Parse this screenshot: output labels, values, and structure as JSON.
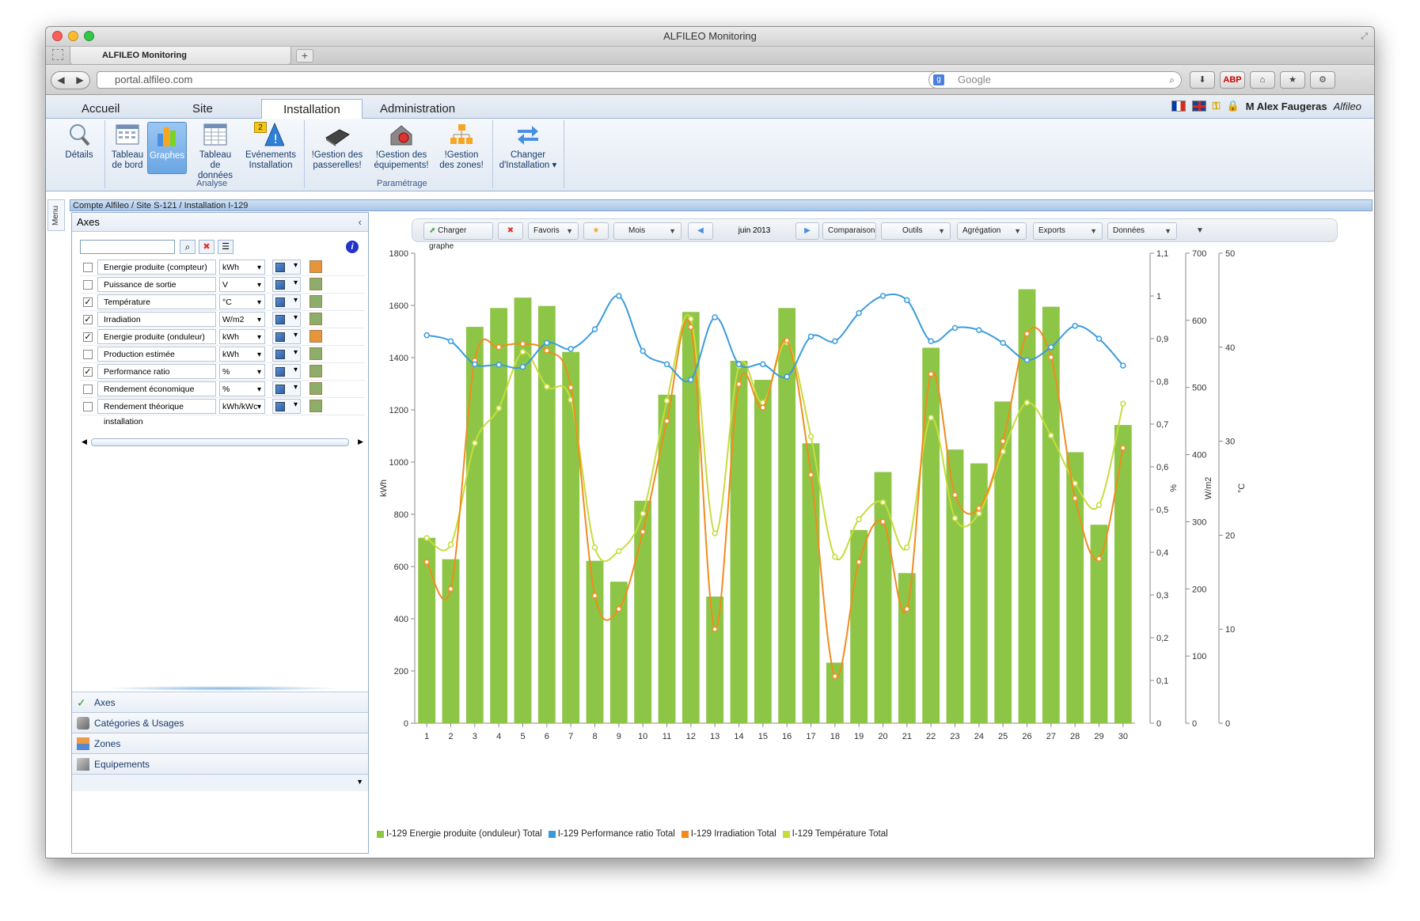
{
  "window": {
    "title": "ALFILEO Monitoring"
  },
  "browser": {
    "tab_title": "ALFILEO Monitoring",
    "url": "portal.alfileo.com",
    "search_placeholder": "Google"
  },
  "ribbon_tabs": [
    "Accueil",
    "Site",
    "Installation",
    "Administration"
  ],
  "user": {
    "name": "M Alex Faugeras",
    "org": "Alfileo"
  },
  "ribbon": {
    "details": "Détails",
    "tableau_bord": [
      "Tableau",
      "de bord"
    ],
    "graphes": "Graphes",
    "tableau_donnees": [
      "Tableau",
      "de données"
    ],
    "evenements": [
      "Evénements",
      "Installation"
    ],
    "evenements_badge": "2",
    "gestion_passerelles": [
      "!Gestion des",
      "passerelles!"
    ],
    "gestion_equipements": [
      "!Gestion des",
      "équipements!"
    ],
    "gestion_zones": [
      "!Gestion",
      "des zones!"
    ],
    "changer": [
      "Changer",
      "d'Installation ▾"
    ],
    "group_analyse": "Analyse",
    "group_parametrage": "Paramétrage"
  },
  "breadcrumb": "Compte Alfileo / Site S-121 / Installation I-129",
  "menu_tab": "Menu",
  "panel": {
    "title": "Axes",
    "rows": [
      {
        "name": "Energie produite (compteur)",
        "unit": "kWh",
        "checked": false,
        "color": "#e8943a"
      },
      {
        "name": "Puissance de sortie",
        "unit": "V",
        "checked": false,
        "color": "#8cae6a"
      },
      {
        "name": "Température",
        "unit": "°C",
        "checked": true,
        "color": "#8cae6a"
      },
      {
        "name": "Irradiation",
        "unit": "W/m2",
        "checked": true,
        "color": "#8cae6a"
      },
      {
        "name": "Energie produite (onduleur)",
        "unit": "kWh",
        "checked": true,
        "color": "#e8943a"
      },
      {
        "name": "Production estimée",
        "unit": "kWh",
        "checked": false,
        "color": "#8cae6a"
      },
      {
        "name": "Performance ratio",
        "unit": "%",
        "checked": true,
        "color": "#8cae6a"
      },
      {
        "name": "Rendement économique installation",
        "unit": "%",
        "checked": false,
        "color": "#8cae6a"
      },
      {
        "name": "Rendement théorique installation",
        "unit": "kWh/kWc",
        "checked": false,
        "color": "#8cae6a"
      }
    ],
    "accordion": [
      "Axes",
      "Catégories & Usages",
      "Zones",
      "Equipements"
    ]
  },
  "chart_toolbar": {
    "charger": "Charger graphe",
    "favoris": "Favoris",
    "mois": "Mois",
    "period": "juin 2013",
    "comparaison": "Comparaison",
    "outils": "Outils",
    "agregation": "Agrégation",
    "exports": "Exports",
    "donnees": "Données"
  },
  "chart_data": {
    "type": "bar",
    "categories": [
      "1",
      "2",
      "3",
      "4",
      "5",
      "6",
      "7",
      "8",
      "9",
      "10",
      "11",
      "12",
      "13",
      "14",
      "15",
      "16",
      "17",
      "18",
      "19",
      "20",
      "21",
      "22",
      "23",
      "24",
      "25",
      "26",
      "27",
      "28",
      "29",
      "30"
    ],
    "series": [
      {
        "name": "I-129 Energie produite (onduleur) Total",
        "type": "bar",
        "axis": "kWh",
        "color": "#8dc647",
        "values": [
          710,
          628,
          1518,
          1590,
          1630,
          1598,
          1422,
          622,
          542,
          852,
          1258,
          1575,
          485,
          1388,
          1315,
          1590,
          1072,
          232,
          740,
          962,
          575,
          1438,
          1048,
          995,
          1232,
          1662,
          1595,
          1038,
          760,
          1142
        ]
      },
      {
        "name": "I-129 Performance ratio Total",
        "type": "line",
        "axis": "%",
        "color": "#3a9bdc",
        "values": [
          0.908,
          0.894,
          0.84,
          0.839,
          0.834,
          0.89,
          0.876,
          0.922,
          1.0,
          0.871,
          0.84,
          0.804,
          0.95,
          0.84,
          0.84,
          0.811,
          0.905,
          0.894,
          0.96,
          1.0,
          0.99,
          0.894,
          0.925,
          0.92,
          0.89,
          0.85,
          0.88,
          0.93,
          0.9,
          0.837
        ]
      },
      {
        "name": "I-129 Irradiation Total",
        "type": "line",
        "axis": "W/m2",
        "color": "#f08c1e",
        "values": [
          240,
          200,
          540,
          560,
          565,
          555,
          500,
          190,
          170,
          285,
          450,
          590,
          140,
          505,
          470,
          570,
          370,
          70,
          240,
          300,
          170,
          520,
          340,
          320,
          420,
          580,
          545,
          335,
          245,
          410
        ]
      },
      {
        "name": "I-129 Température Total",
        "type": "line",
        "axis": "°C",
        "color": "#c7dc3c",
        "values": [
          19.7,
          19.0,
          29.8,
          33.5,
          39.5,
          35.8,
          34.4,
          18.7,
          18.3,
          22.3,
          34.3,
          43.0,
          20.2,
          38.0,
          34.1,
          40.5,
          30.5,
          17.7,
          21.7,
          23.5,
          18.7,
          32.5,
          21.8,
          22.3,
          28.9,
          34.1,
          30.6,
          25.5,
          23.2,
          34.0
        ]
      }
    ],
    "axes": {
      "kWh": {
        "label": "kWh",
        "ticks": [
          "0",
          "200",
          "400",
          "600",
          "800",
          "1000",
          "1200",
          "1400",
          "1600",
          "1800"
        ],
        "range": [
          0,
          1800
        ]
      },
      "%": {
        "label": "%",
        "ticks": [
          "0",
          "0,1",
          "0,2",
          "0,3",
          "0,4",
          "0,5",
          "0,6",
          "0,7",
          "0,8",
          "0,9",
          "1",
          "1,1"
        ],
        "range": [
          0,
          1.1
        ]
      },
      "W/m2": {
        "label": "W/m2",
        "ticks": [
          "0",
          "100",
          "200",
          "300",
          "400",
          "500",
          "600",
          "700"
        ],
        "range": [
          0,
          700
        ]
      },
      "°C": {
        "label": "°C",
        "ticks": [
          "0",
          "10",
          "20",
          "30",
          "40",
          "50"
        ],
        "range": [
          0,
          50
        ]
      }
    },
    "legend": "bottom"
  }
}
